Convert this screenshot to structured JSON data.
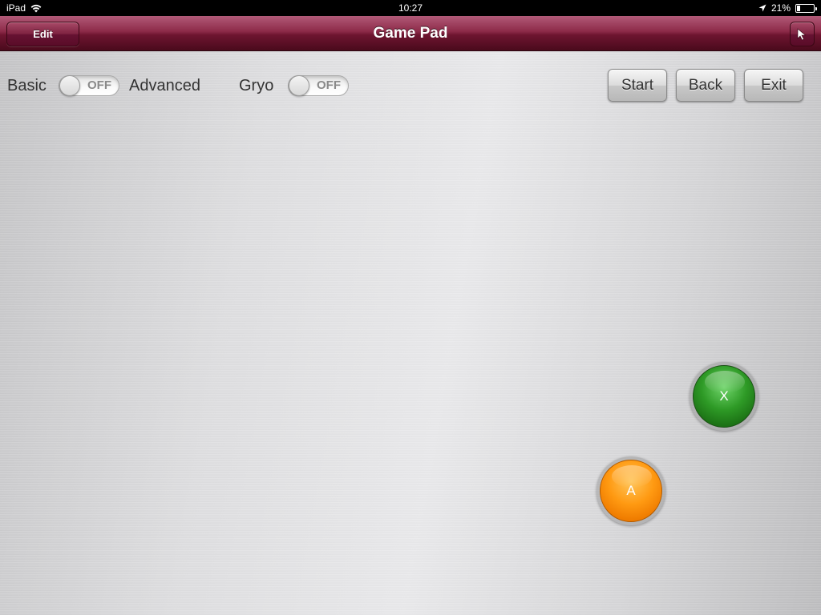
{
  "status_bar": {
    "device": "iPad",
    "time": "10:27",
    "battery": "21%",
    "battery_level": 0.21,
    "icons": [
      "wifi-icon",
      "location-icon",
      "battery-icon"
    ]
  },
  "nav_bar": {
    "title": "Game Pad",
    "edit_label": "Edit",
    "pointer_icon": "cursor-arrow-icon",
    "color": "#7a1a3a"
  },
  "controls": {
    "basic_label": "Basic",
    "advanced_label": "Advanced",
    "mode_toggle": "OFF",
    "gyro_label": "Gryo",
    "gyro_toggle": "OFF"
  },
  "actions": {
    "start": "Start",
    "back": "Back",
    "exit": "Exit"
  },
  "game_buttons": {
    "x": {
      "label": "X",
      "color": "#2e9a26"
    },
    "a": {
      "label": "A",
      "color": "#ff9a12"
    }
  }
}
